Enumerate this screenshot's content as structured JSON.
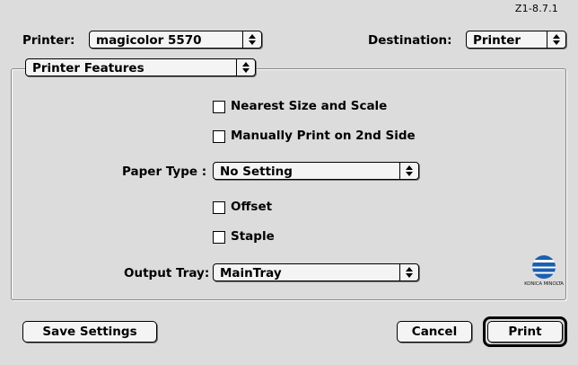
{
  "dialog": {
    "version": "Z1-8.7.1"
  },
  "printer": {
    "label": "Printer:",
    "value": "magicolor 5570"
  },
  "destination": {
    "label": "Destination:",
    "value": "Printer"
  },
  "panel_menu": {
    "value": "Printer Features"
  },
  "options": {
    "nearest_size": {
      "label": "Nearest Size and Scale",
      "checked": false
    },
    "manual_duplex": {
      "label": "Manually Print on 2nd Side",
      "checked": false
    },
    "paper_type": {
      "label": "Paper Type :",
      "value": "No Setting"
    },
    "offset": {
      "label": "Offset",
      "checked": false
    },
    "staple": {
      "label": "Staple",
      "checked": false
    },
    "output_tray": {
      "label": "Output Tray:",
      "value": "MainTray"
    }
  },
  "logo": {
    "brand_text": "KONICA MINOLTA",
    "icon": "konica-minolta-globe-icon",
    "color": "#1c5fb0"
  },
  "buttons": {
    "save_settings": "Save Settings",
    "cancel": "Cancel",
    "print": "Print"
  }
}
